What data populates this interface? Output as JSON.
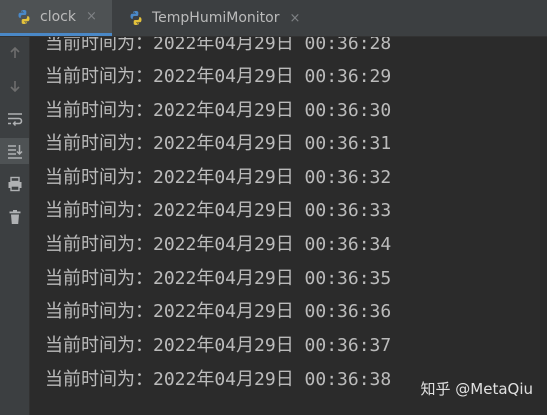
{
  "tabs": [
    {
      "label": "clock",
      "icon": "python-file-icon",
      "active": true
    },
    {
      "label": "TempHumiMonitor",
      "icon": "python-file-icon",
      "active": false
    }
  ],
  "tab_close_glyph": "×",
  "gutter": {
    "buttons": [
      "scroll-up-icon",
      "scroll-down-icon",
      "soft-wrap-icon",
      "scroll-to-end-icon",
      "print-icon",
      "trash-icon"
    ]
  },
  "console": {
    "lines": [
      "当前时间为：2022年04月29日 00:36:28",
      "当前时间为：2022年04月29日 00:36:29",
      "当前时间为：2022年04月29日 00:36:30",
      "当前时间为：2022年04月29日 00:36:31",
      "当前时间为：2022年04月29日 00:36:32",
      "当前时间为：2022年04月29日 00:36:33",
      "当前时间为：2022年04月29日 00:36:34",
      "当前时间为：2022年04月29日 00:36:35",
      "当前时间为：2022年04月29日 00:36:36",
      "当前时间为：2022年04月29日 00:36:37",
      "当前时间为：2022年04月29日 00:36:38"
    ]
  },
  "watermark": "知乎 @MetaQiu",
  "colors": {
    "background": "#2b2b2b",
    "toolbar": "#3c3f41",
    "text": "#bbbbbb",
    "tab_accent": "#4a88c7"
  }
}
